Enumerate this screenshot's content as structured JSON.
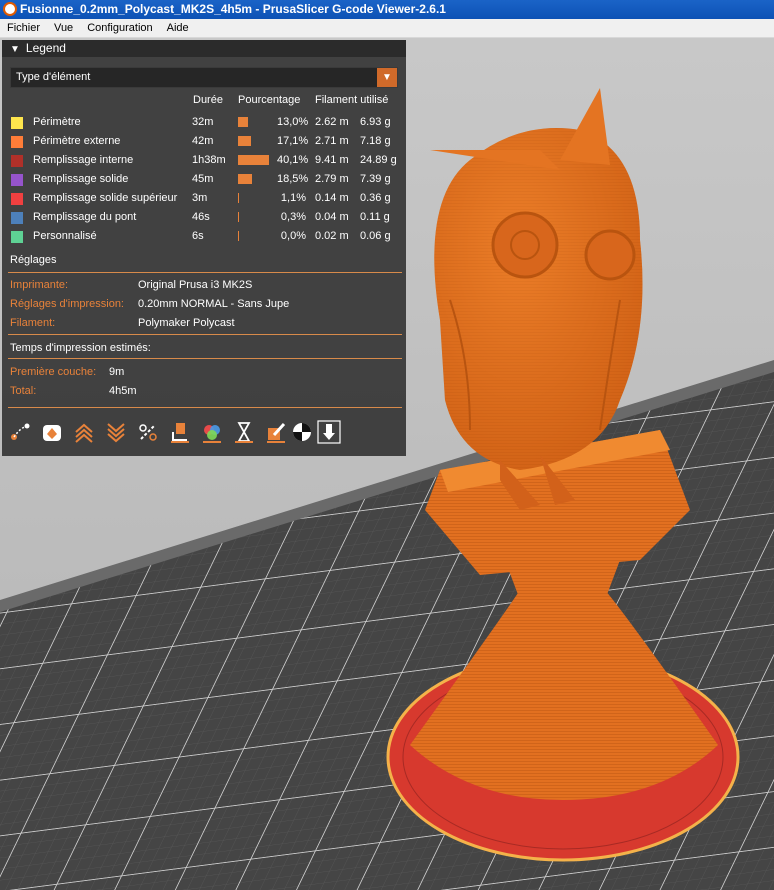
{
  "window": {
    "title": "Fusionne_0.2mm_Polycast_MK2S_4h5m - PrusaSlicer G-code Viewer-2.6.1"
  },
  "menu": [
    "Fichier",
    "Vue",
    "Configuration",
    "Aide"
  ],
  "legend": {
    "title": "Legend",
    "view_type": "Type d'élément",
    "columns": {
      "duration": "Durée",
      "percentage": "Pourcentage",
      "filament": "Filament utilisé"
    },
    "rows": [
      {
        "name": "Périmètre",
        "color": "#ffe64d",
        "duration": "32m",
        "pct": "13,0%",
        "pct_value": 13.0,
        "length": "2.62 m",
        "weight": "6.93 g"
      },
      {
        "name": "Périmètre externe",
        "color": "#ff7d38",
        "duration": "42m",
        "pct": "17,1%",
        "pct_value": 17.1,
        "length": "2.71 m",
        "weight": "7.18 g"
      },
      {
        "name": "Remplissage interne",
        "color": "#b03029",
        "duration": "1h38m",
        "pct": "40,1%",
        "pct_value": 40.1,
        "length": "9.41 m",
        "weight": "24.89 g"
      },
      {
        "name": "Remplissage solide",
        "color": "#9654cc",
        "duration": "45m",
        "pct": "18,5%",
        "pct_value": 18.5,
        "length": "2.79 m",
        "weight": "7.39 g"
      },
      {
        "name": "Remplissage solide supérieur",
        "color": "#f04040",
        "duration": "3m",
        "pct": "1,1%",
        "pct_value": 1.1,
        "length": "0.14 m",
        "weight": "0.36 g"
      },
      {
        "name": "Remplissage du pont",
        "color": "#4d80ba",
        "duration": "46s",
        "pct": "0,3%",
        "pct_value": 0.3,
        "length": "0.04 m",
        "weight": "0.11 g"
      },
      {
        "name": "Personnalisé",
        "color": "#5ed194",
        "duration": "6s",
        "pct": "0,0%",
        "pct_value": 0.0,
        "length": "0.02 m",
        "weight": "0.06 g"
      }
    ],
    "settings": {
      "heading": "Réglages",
      "printer_label": "Imprimante:",
      "printer": "Original Prusa i3 MK2S",
      "print_label": "Réglages d'impression:",
      "print": "0.20mm NORMAL - Sans Jupe",
      "filament_label": "Filament:",
      "filament": "Polymaker Polycast"
    },
    "estimates": {
      "heading": "Temps d'impression estimés:",
      "first_layer_label": "Première couche:",
      "first_layer": "9m",
      "total_label": "Total:",
      "total": "4h5m"
    },
    "toolbar_icons": [
      "travel-icon",
      "wipe-icon",
      "retractions-icon",
      "deretractions-icon",
      "seams-icon",
      "tool-changes-icon",
      "color-changes-icon",
      "pause-icon",
      "custom-gcode-icon",
      "center-of-gravity-icon",
      "tool-marker-icon"
    ]
  },
  "colors": {
    "accent": "#e8823a",
    "model": "#e06a18"
  }
}
